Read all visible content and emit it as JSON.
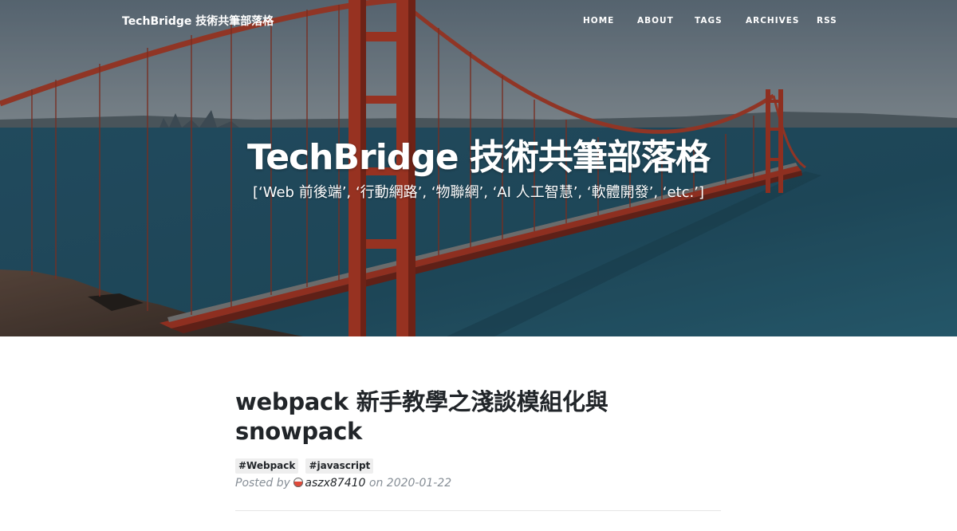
{
  "nav": {
    "brand": "TechBridge 技術共筆部落格",
    "items": [
      {
        "label": "HOME"
      },
      {
        "label": "ABOUT"
      },
      {
        "label": "TAGS"
      },
      {
        "label": "ARCHIVES"
      },
      {
        "label": "RSS"
      }
    ]
  },
  "hero": {
    "title": "TechBridge 技術共筆部落格",
    "subtitle": "[‘Web 前後端’, ‘行動網路’, ‘物聯網’, ‘AI 人工智慧’, ‘軟體開發’, ‘etc.’]"
  },
  "post": {
    "title": "webpack 新手教學之淺談模組化與 snowpack",
    "tags": [
      {
        "label": "#Webpack"
      },
      {
        "label": "#javascript"
      }
    ],
    "meta": {
      "posted_by": "Posted by",
      "author": "aszx87410",
      "on": "on",
      "date": "2020-01-22"
    }
  },
  "colors": {
    "text": "#212529",
    "muted": "#868e96",
    "tag_bg": "#eeeeee",
    "bridge_red": "#c2412b",
    "ocean": "#2d6379"
  }
}
